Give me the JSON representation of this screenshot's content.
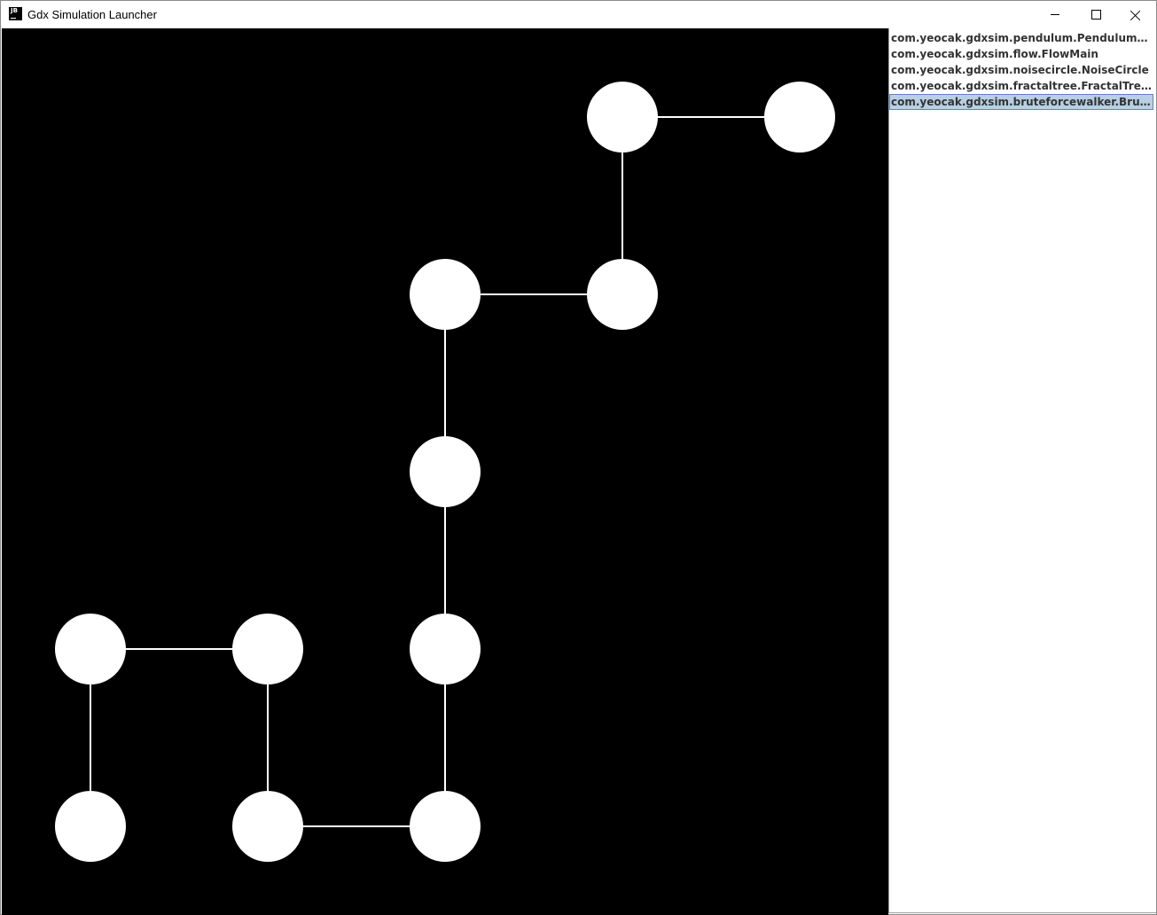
{
  "window": {
    "title": "Gdx Simulation Launcher",
    "icon": "jetbrains-jb-icon",
    "icon_text": "JB",
    "controls": {
      "minimize_icon": "minimize-icon",
      "maximize_icon": "maximize-icon",
      "close_icon": "close-icon"
    }
  },
  "simulation_list": {
    "items": [
      {
        "label": "com.yeocak.gdxsim.pendulum.PendulumMain",
        "selected": false
      },
      {
        "label": "com.yeocak.gdxsim.flow.FlowMain",
        "selected": false
      },
      {
        "label": "com.yeocak.gdxsim.noisecircle.NoiseCircle",
        "selected": false
      },
      {
        "label": "com.yeocak.gdxsim.fractaltree.FractalTreeMain",
        "selected": false
      },
      {
        "label": "com.yeocak.gdxsim.bruteforcewalker.BruteForce...",
        "selected": true
      }
    ],
    "selected_color": "#b8cfe5"
  },
  "walker_canvas": {
    "background": "#000000",
    "foreground": "#ffffff",
    "path": [
      [
        0,
        0
      ],
      [
        0,
        1
      ],
      [
        1,
        1
      ],
      [
        1,
        0
      ],
      [
        2,
        0
      ],
      [
        2,
        1
      ],
      [
        2,
        2
      ],
      [
        2,
        3
      ],
      [
        3,
        3
      ],
      [
        3,
        4
      ],
      [
        4,
        4
      ]
    ]
  }
}
